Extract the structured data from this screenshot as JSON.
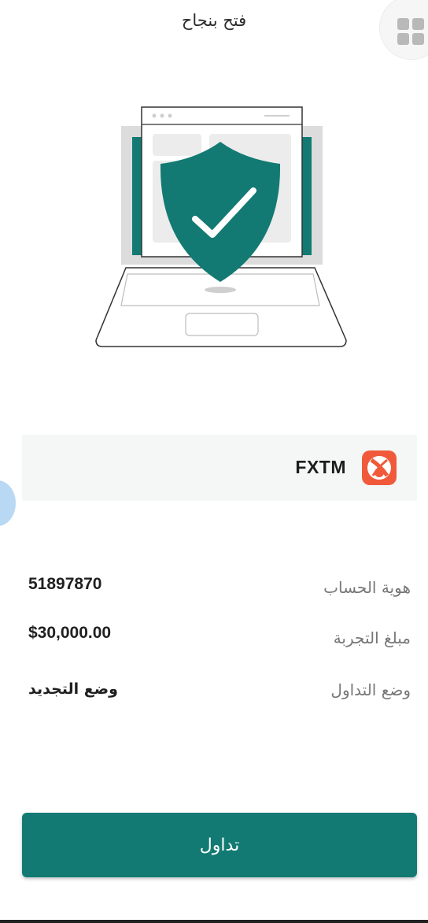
{
  "header": {
    "title": "فتح بنجاح",
    "menu_icon": "grid-icon"
  },
  "illustration": {
    "icon": "shield-check-icon",
    "accent_color": "#137a73"
  },
  "broker": {
    "name": "FXTM",
    "logo_icon": "fxtm-logo-icon",
    "logo_color": "#f05a3a"
  },
  "details": {
    "account_id_label": "هوية الحساب",
    "account_id_value": "51897870",
    "trial_amount_label": "مبلغ التجربة",
    "trial_amount_value": "$30,000.00",
    "trade_mode_label": "وضع التداول",
    "trade_mode_value": "وضع التجديد"
  },
  "actions": {
    "trade_button_label": "تداول"
  },
  "colors": {
    "primary": "#137a73",
    "card_bg": "#f5f7f6"
  }
}
